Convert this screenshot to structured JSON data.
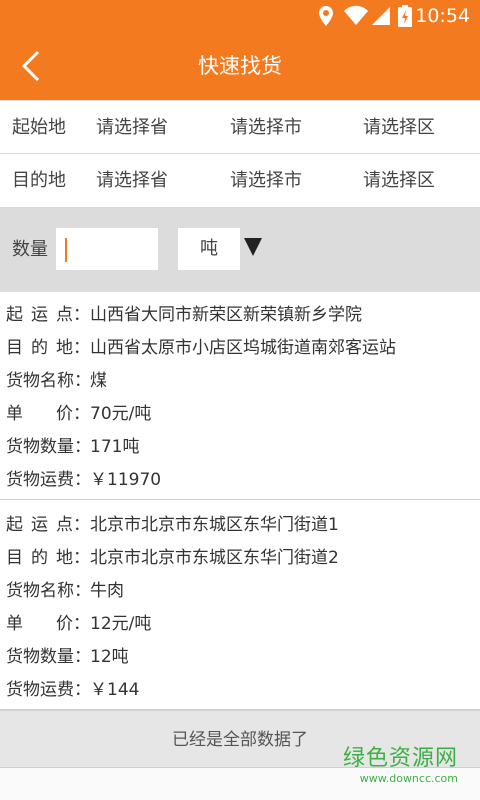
{
  "status_bar": {
    "time": "10:54",
    "icons": [
      "location-icon",
      "wifi-icon",
      "signal-icon",
      "battery-icon"
    ]
  },
  "app_bar": {
    "title": "快速找货",
    "back_icon": "chevron-left-icon"
  },
  "origin": {
    "label": "起始地",
    "province": "请选择省",
    "city": "请选择市",
    "district": "请选择区"
  },
  "destination": {
    "label": "目的地",
    "province": "请选择省",
    "city": "请选择市",
    "district": "请选择区"
  },
  "quantity": {
    "label": "数量",
    "value": "",
    "unit": "吨"
  },
  "cargo_list": [
    {
      "origin_label": "起运点：",
      "origin": "山西省大同市新荣区新荣镇新乡学院",
      "dest_label": "目的地：",
      "dest": "山西省太原市小店区坞城街道南郊客运站",
      "name_label": "货物名称：",
      "name": "煤",
      "price_label": "单价：",
      "price": "70元/吨",
      "qty_label": "货物数量：",
      "qty": "171吨",
      "fee_label": "货物运费：",
      "fee": "￥11970"
    },
    {
      "origin_label": "起运点：",
      "origin": "北京市北京市东城区东华门街道1",
      "dest_label": "目的地：",
      "dest": "北京市北京市东城区东华门街道2",
      "name_label": "货物名称：",
      "name": "牛肉",
      "price_label": "单价：",
      "price": "12元/吨",
      "qty_label": "货物数量：",
      "qty": "12吨",
      "fee_label": "货物运费：",
      "fee": "￥144"
    }
  ],
  "footer": {
    "text": "已经是全部数据了"
  },
  "watermark": {
    "cn": "绿色资源网",
    "en": "www.downcc.com"
  },
  "colors": {
    "primary": "#f47a1f",
    "watermark": "#3cb043"
  }
}
